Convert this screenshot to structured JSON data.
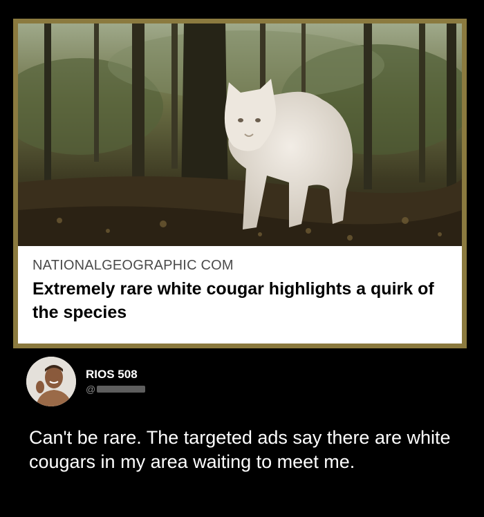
{
  "link_card": {
    "image_description_name": "white-cougar-photo",
    "source": "NATIONALGEOGRAPHIC COM",
    "headline": "Extremely rare white cougar highlights a quirk of the species",
    "border_color": "#8b7a3f"
  },
  "post": {
    "username": "RIOS 508",
    "handle_prefix": "@",
    "text": "Can't be rare. The targeted ads say there are white cougars in my area waiting to meet me."
  }
}
